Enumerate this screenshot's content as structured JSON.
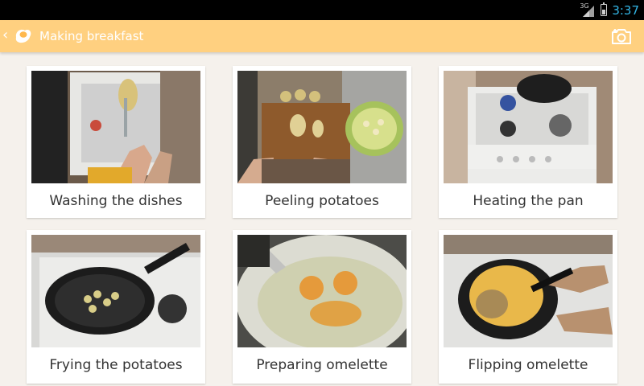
{
  "status_bar": {
    "network": "3G",
    "time": "3:37",
    "battery_level": 0.45
  },
  "action_bar": {
    "title": "Making breakfast",
    "camera_icon": "camera-icon",
    "app_icon": "egg-app-icon"
  },
  "cards": [
    {
      "label": "Washing the dishes"
    },
    {
      "label": "Peeling potatoes"
    },
    {
      "label": "Heating the pan"
    },
    {
      "label": "Frying the potatoes"
    },
    {
      "label": "Preparing omelette"
    },
    {
      "label": "Flipping omelette"
    }
  ],
  "colors": {
    "accent": "#ffd080",
    "status_time": "#33b5e5",
    "background": "#f5f1ec"
  }
}
